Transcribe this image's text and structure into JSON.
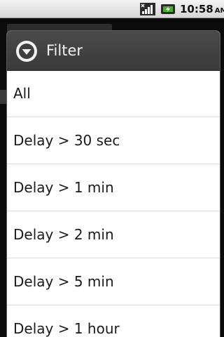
{
  "status_bar": {
    "time": "10:58",
    "ampm": "AM",
    "icons": [
      "signal-icon",
      "battery-icon"
    ]
  },
  "dialog": {
    "title": "Filter",
    "title_icon": "dropdown-circle-icon",
    "options": [
      {
        "label": "All"
      },
      {
        "label": "Delay > 30 sec"
      },
      {
        "label": "Delay > 1 min"
      },
      {
        "label": "Delay > 2 min"
      },
      {
        "label": "Delay > 5 min"
      },
      {
        "label": "Delay > 1 hour"
      }
    ]
  },
  "colors": {
    "header_bg": "#3f3f3f",
    "list_bg": "#ffffff",
    "text": "#1a1a1a",
    "divider": "#dcdcdc"
  }
}
